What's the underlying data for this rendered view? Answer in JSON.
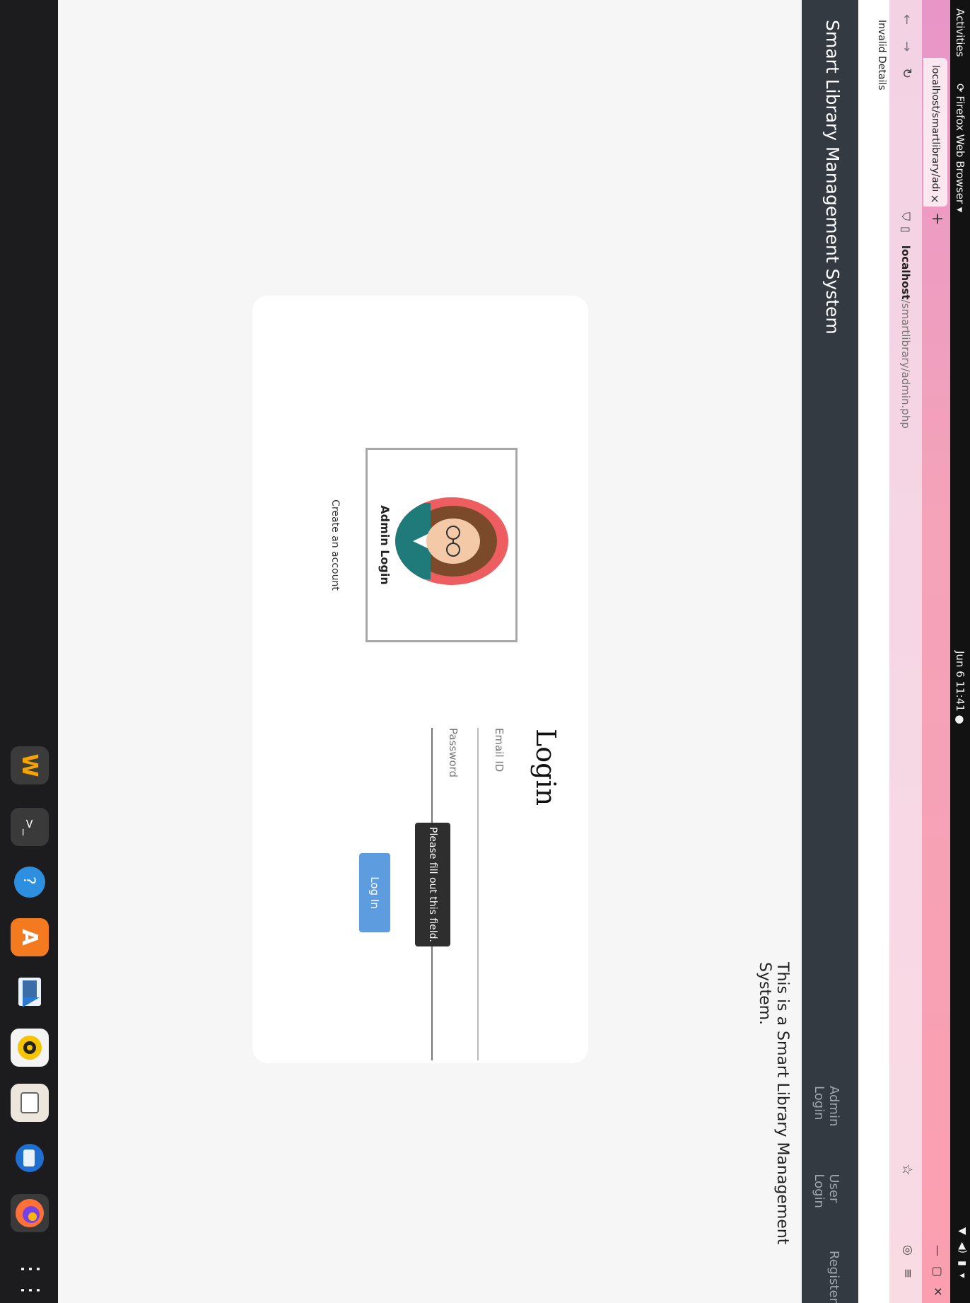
{
  "system_bar": {
    "activities": "Activities",
    "app_name": "Firefox Web Browser",
    "clock": "Jun 6  11:41"
  },
  "browser": {
    "tab_title": "localhost/smartlibrary/admi",
    "url_host": "localhost",
    "url_path": "/smartlibrary/admin.php",
    "invalid_message": "Invalid Details"
  },
  "site": {
    "brand": "Smart Library Management System",
    "nav_links": [
      "Admin Login",
      "User Login",
      "Register"
    ],
    "tagline": "This is a Smart Library Management System."
  },
  "login": {
    "admin_caption": "Admin Login",
    "create_account": "Create an account",
    "title": "Login",
    "email_label": "Email ID",
    "password_label": "Password",
    "tooltip": "Please fill out this field.",
    "button": "Log In"
  },
  "colors": {
    "navbar_bg": "#333a41",
    "button_bg": "#5d9ddf",
    "avatar_bg": "#ee5d5f"
  },
  "dock_icons": [
    "firefox-icon",
    "thunderbird-icon",
    "files-icon",
    "rhythmbox-icon",
    "video-icon",
    "software-center-icon",
    "help-icon",
    "terminal-icon",
    "store-icon",
    "show-apps-icon"
  ]
}
